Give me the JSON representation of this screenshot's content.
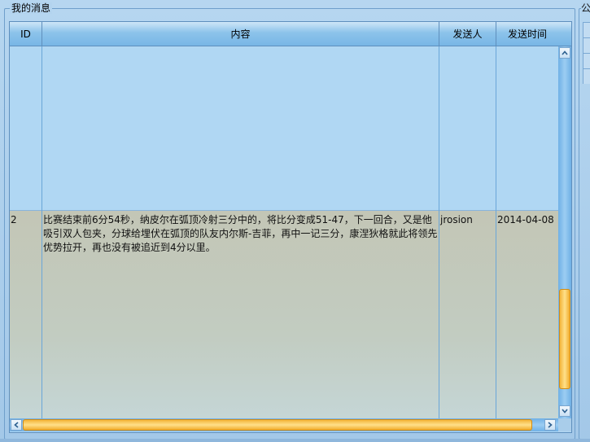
{
  "group": {
    "title": "我的消息"
  },
  "right_group": {
    "title": "公"
  },
  "table": {
    "columns": [
      "ID",
      "内容",
      "发送人",
      "发送时间"
    ],
    "rows": [
      {
        "id": "2",
        "content": "比赛结束前6分54秒，纳皮尔在弧顶冷射三分中的，将比分变成51-47，下一回合，又是他吸引双人包夹，分球给埋伏在弧顶的队友内尔斯-吉菲，再中一记三分，康涅狄格就此将领先优势拉开，再也没有被追近到4分以里。",
        "sender": "jrosion",
        "time": "2014-04-08"
      }
    ]
  },
  "scroll": {
    "vertical_position": 0.68,
    "horizontal_position": 0.0
  },
  "icons": {
    "scroll_up": "chevron-up-icon",
    "scroll_down": "chevron-down-icon",
    "scroll_left": "chevron-left-icon",
    "scroll_right": "chevron-right-icon"
  }
}
